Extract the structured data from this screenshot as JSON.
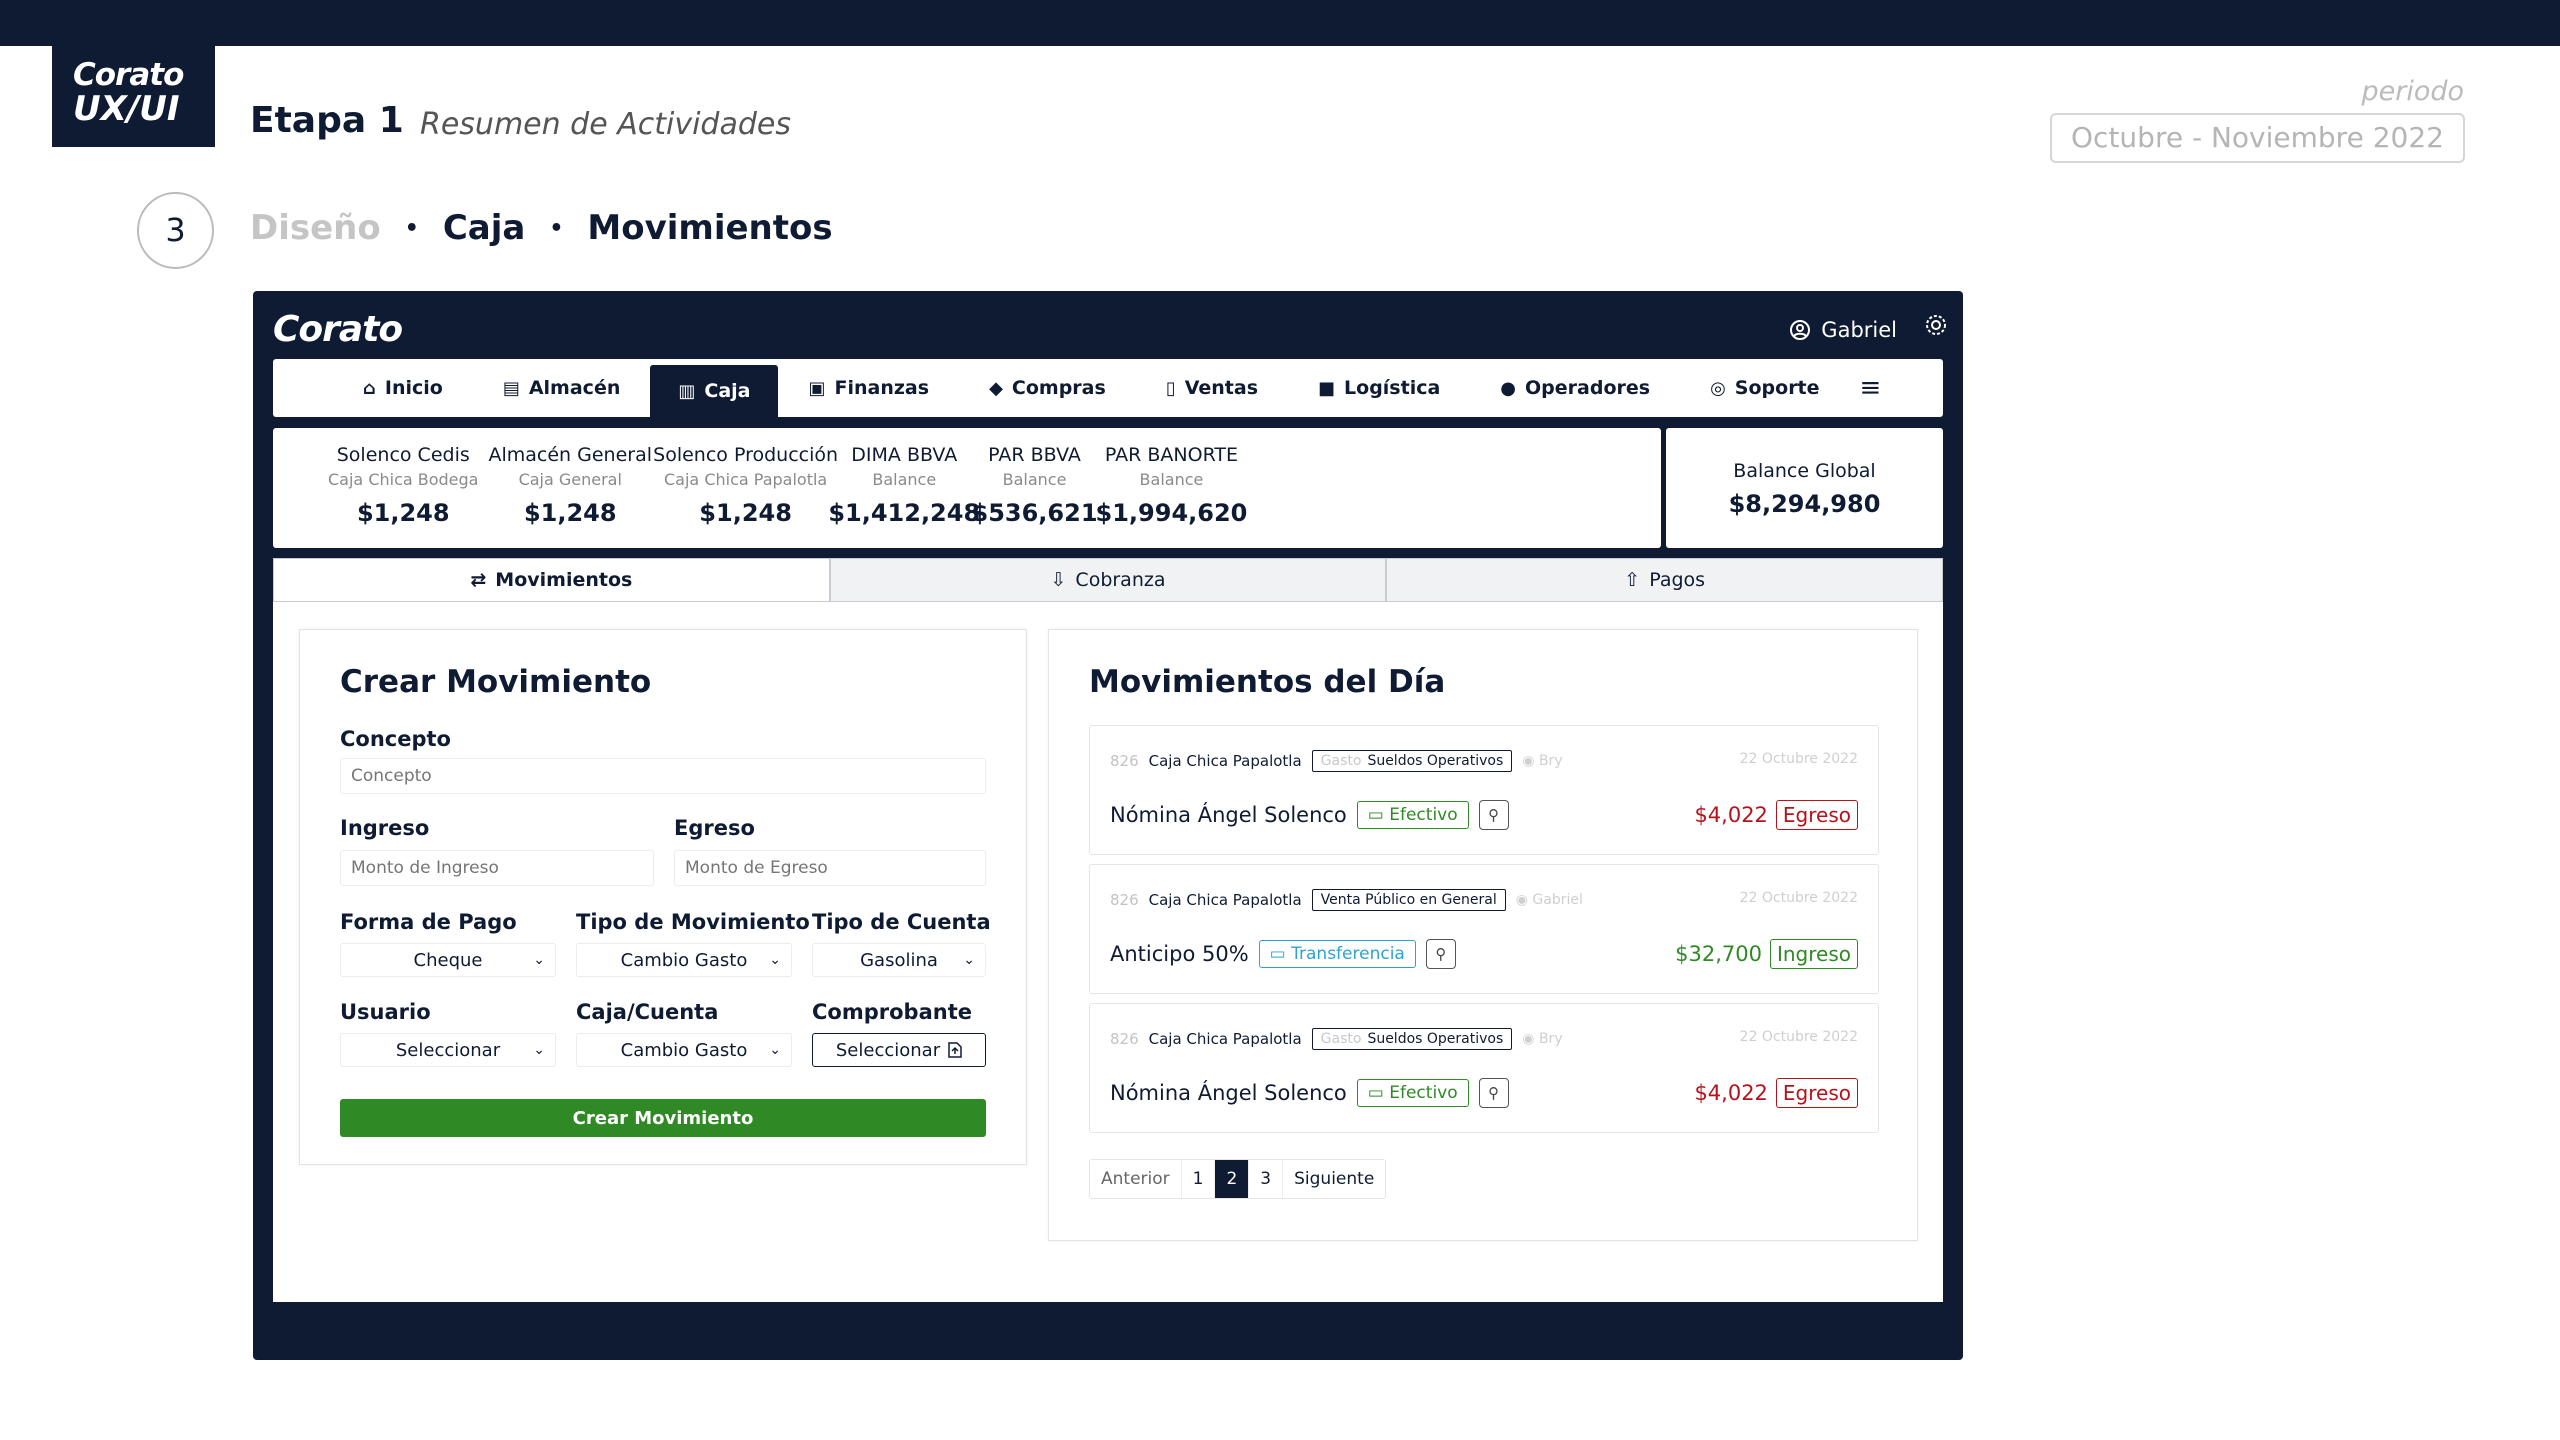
{
  "slide": {
    "logo_line1": "Corato",
    "logo_line2": "UX/UI",
    "stage": "Etapa 1",
    "stage_subtitle": "Resumen de Actividades",
    "period_label": "periodo",
    "period_value": "Octubre - Noviembre 2022",
    "step_number": "3",
    "crumbs": [
      "Diseño",
      "Caja",
      "Movimientos"
    ],
    "crumb_separator": "•"
  },
  "app": {
    "brand": "Corato",
    "user_name": "Gabriel",
    "nav": [
      {
        "label": "Inicio",
        "icon": "home-icon",
        "glyph": "⌂"
      },
      {
        "label": "Almacén",
        "icon": "warehouse-icon",
        "glyph": "▤"
      },
      {
        "label": "Caja",
        "icon": "cash-register-icon",
        "glyph": "▥",
        "active": true
      },
      {
        "label": "Finanzas",
        "icon": "money-icon",
        "glyph": "▣"
      },
      {
        "label": "Compras",
        "icon": "tag-icon",
        "glyph": "◆"
      },
      {
        "label": "Ventas",
        "icon": "receipt-icon",
        "glyph": "▯"
      },
      {
        "label": "Logística",
        "icon": "truck-icon",
        "glyph": "■"
      },
      {
        "label": "Operadores",
        "icon": "user-icon",
        "glyph": "●"
      },
      {
        "label": "Soporte",
        "icon": "headset-icon",
        "glyph": "◎"
      }
    ],
    "menu_glyph": "≡",
    "balances": [
      {
        "title": "Solenco Cedis",
        "sub": "Caja Chica Bodega",
        "value": "$1,248"
      },
      {
        "title": "Almacén General",
        "sub": "Caja General",
        "value": "$1,248"
      },
      {
        "title": "Solenco Producción",
        "sub": "Caja Chica Papalotla",
        "value": "$1,248"
      },
      {
        "title": "DIMA BBVA",
        "sub": "Balance",
        "value": "$1,412,248"
      },
      {
        "title": "PAR BBVA",
        "sub": "Balance",
        "value": "$536,621"
      },
      {
        "title": "PAR BANORTE",
        "sub": "Balance",
        "value": "$1,994,620"
      }
    ],
    "global_balance": {
      "title": "Balance Global",
      "value": "$8,294,980"
    },
    "tabs": [
      {
        "label": "Movimientos",
        "glyph": "⇄"
      },
      {
        "label": "Cobranza",
        "glyph": "⇩"
      },
      {
        "label": "Pagos",
        "glyph": "⇧"
      }
    ]
  },
  "form": {
    "title": "Crear Movimiento",
    "concepto_label": "Concepto",
    "concepto_placeholder": "Concepto",
    "ingreso_label": "Ingreso",
    "ingreso_placeholder": "Monto de Ingreso",
    "egreso_label": "Egreso",
    "egreso_placeholder": "Monto de Egreso",
    "forma_pago_label": "Forma de Pago",
    "forma_pago_value": "Cheque",
    "tipo_mov_label": "Tipo de Movimiento",
    "tipo_mov_value": "Cambio Gasto",
    "tipo_cuenta_label": "Tipo de Cuenta",
    "tipo_cuenta_value": "Gasolina",
    "usuario_label": "Usuario",
    "usuario_value": "Seleccionar",
    "caja_label": "Caja/Cuenta",
    "caja_value": "Cambio Gasto",
    "comprobante_label": "Comprobante",
    "comprobante_value": "Seleccionar",
    "submit": "Crear Movimiento"
  },
  "day": {
    "title": "Movimientos del Día",
    "items": [
      {
        "num": "826",
        "cuenta": "Caja Chica Papalotla",
        "tag_prefix": "Gasto",
        "tag": "Sueldos Operativos",
        "user": "Bry",
        "date": "22 Octubre 2022",
        "concept": "Nómina Ángel Solenco",
        "payment": "Efectivo",
        "amount": "$4,022",
        "kind": "Egreso"
      },
      {
        "num": "826",
        "cuenta": "Caja Chica Papalotla",
        "tag_prefix": "",
        "tag": "Venta Público en General",
        "user": "Gabriel",
        "date": "22 Octubre 2022",
        "concept": "Anticipo 50%",
        "payment": "Transferencia",
        "amount": "$32,700",
        "kind": "Ingreso"
      },
      {
        "num": "826",
        "cuenta": "Caja Chica Papalotla",
        "tag_prefix": "Gasto",
        "tag": "Sueldos Operativos",
        "user": "Bry",
        "date": "22 Octubre 2022",
        "concept": "Nómina Ángel Solenco",
        "payment": "Efectivo",
        "amount": "$4,022",
        "kind": "Egreso"
      }
    ],
    "pager": {
      "prev": "Anterior",
      "pages": [
        "1",
        "2",
        "3"
      ],
      "current": "2",
      "next": "Siguiente"
    }
  },
  "colors": {
    "navy": "#0f1b33",
    "green": "#2f8a25",
    "red": "#b5121b",
    "blue": "#2ba3d6"
  }
}
